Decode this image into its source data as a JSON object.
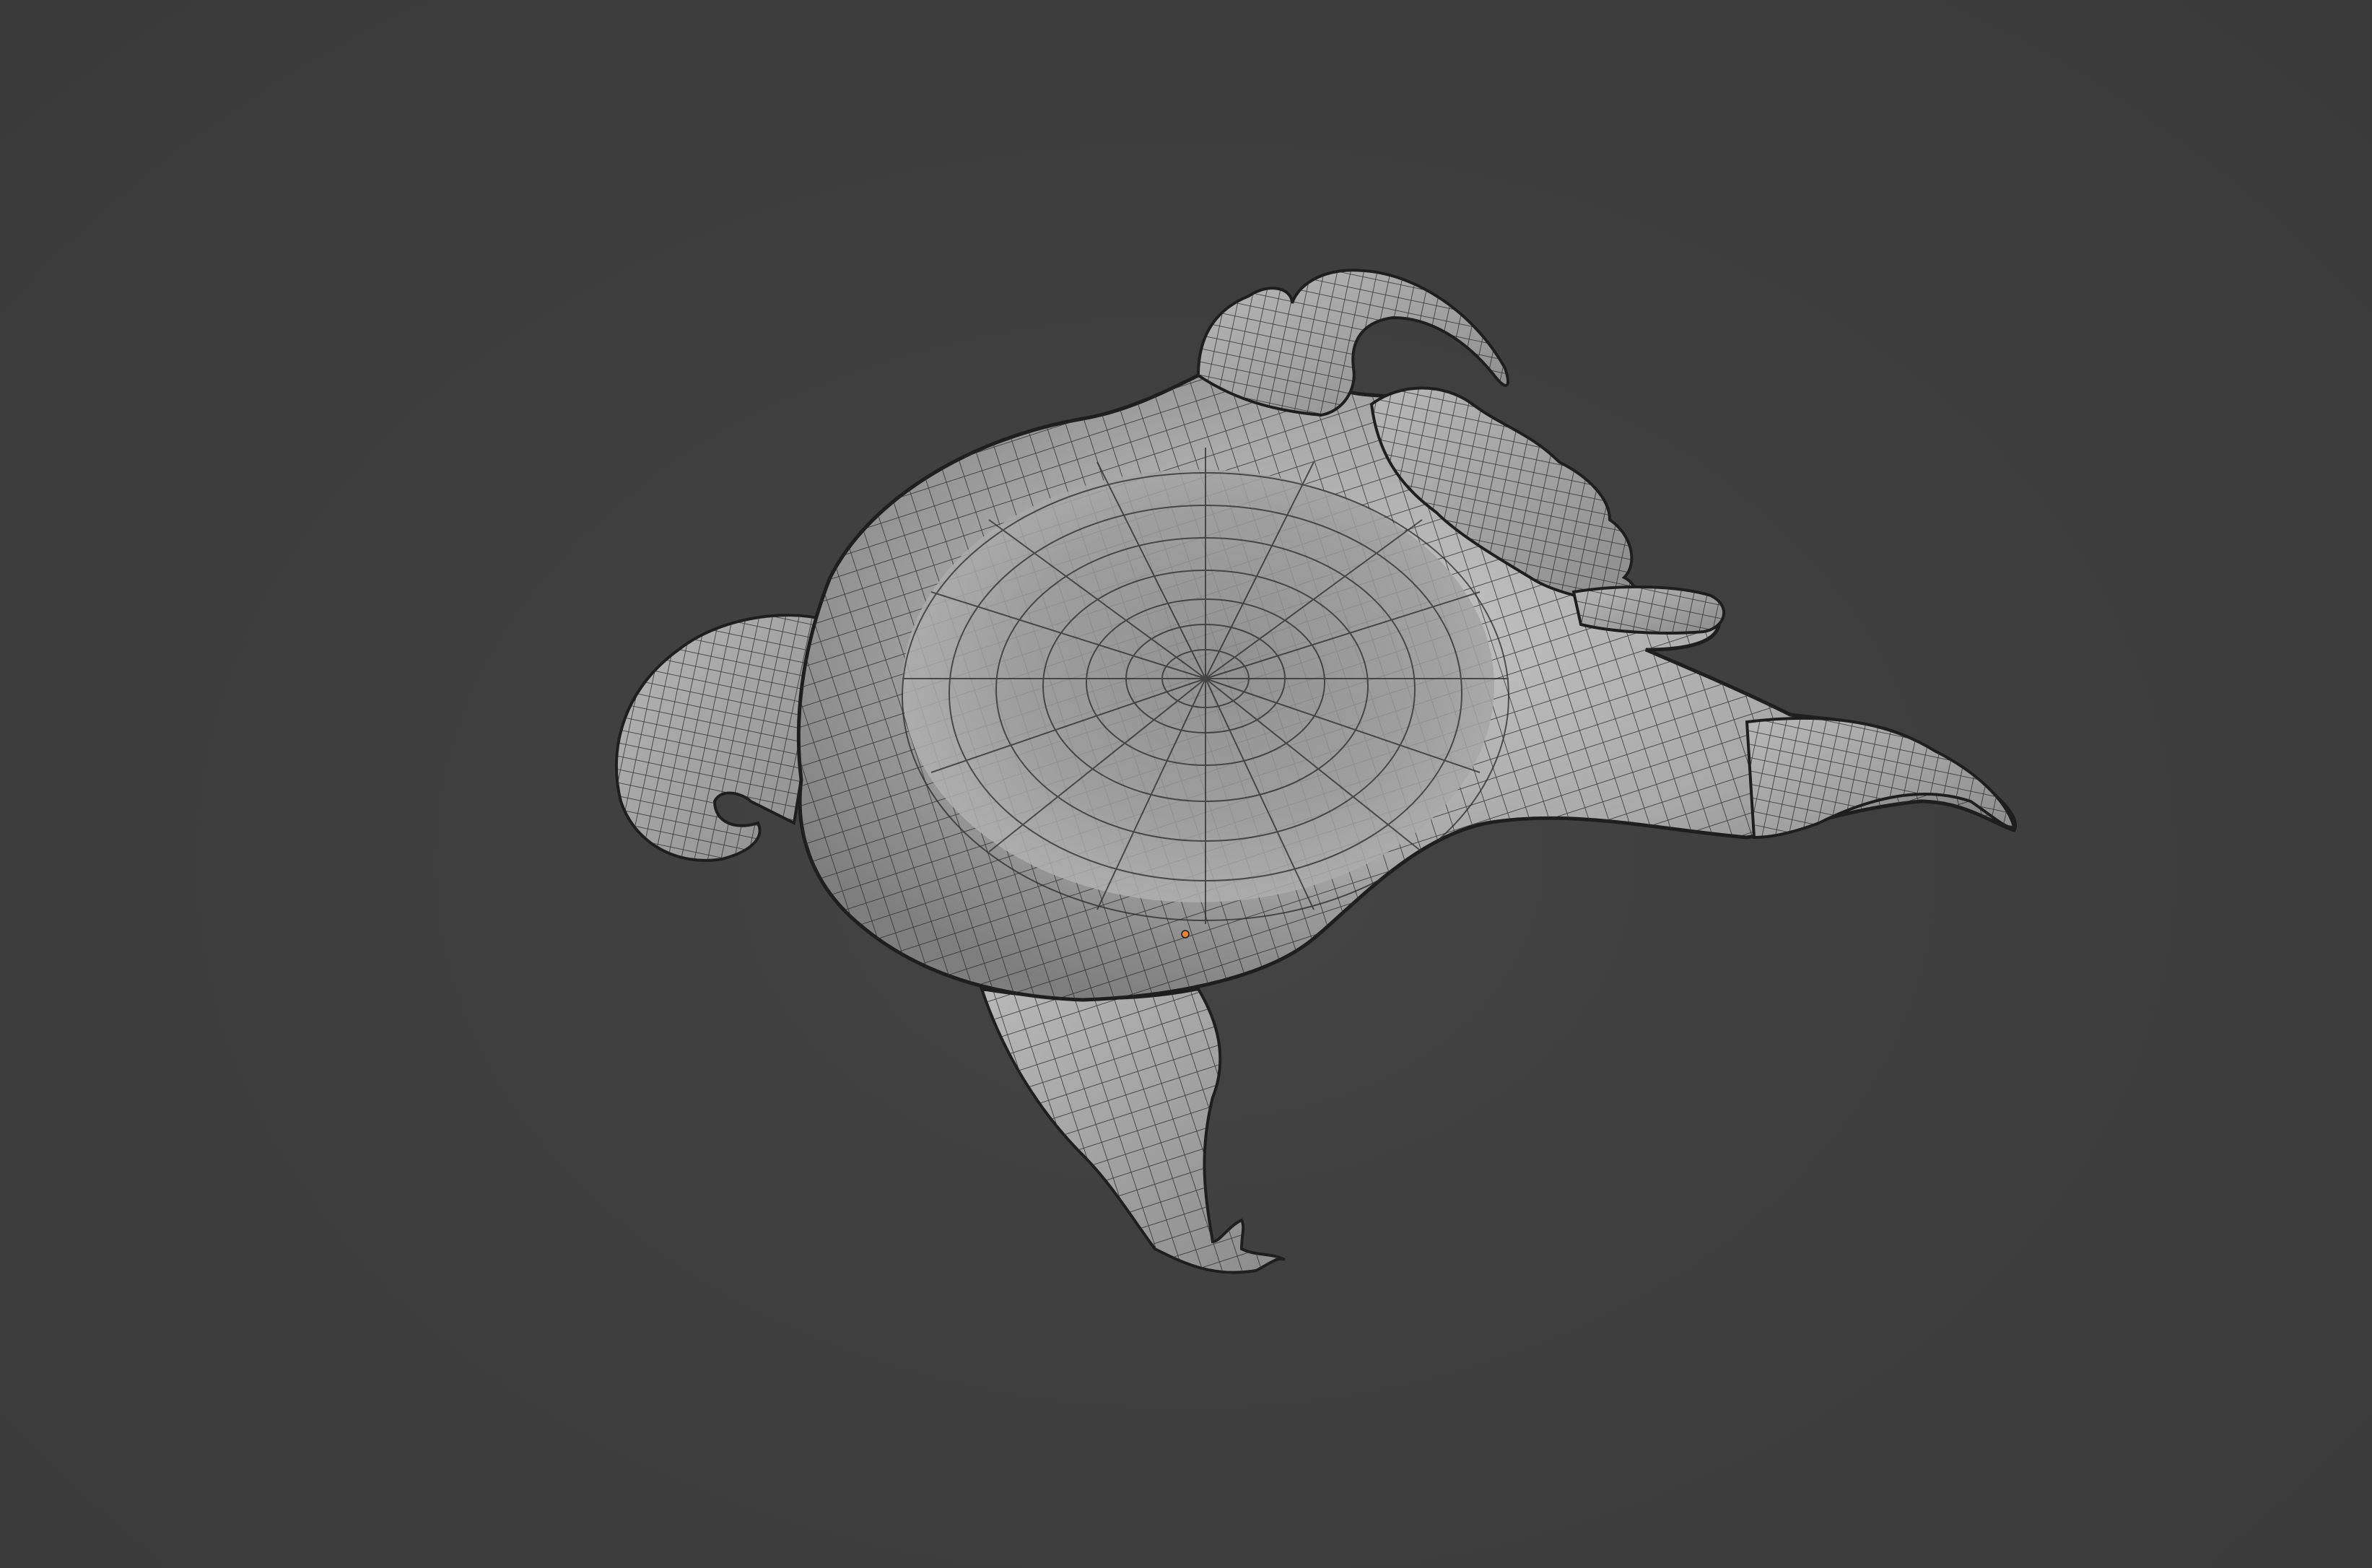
{
  "viewport": {
    "background_color": "#3d3d3d",
    "mesh_color": "#a6a6a6",
    "wire_color": "#1e1e1e",
    "origin_marker_color": "#e8823a",
    "subject": "creature-sculpt-wireframe-mesh"
  }
}
